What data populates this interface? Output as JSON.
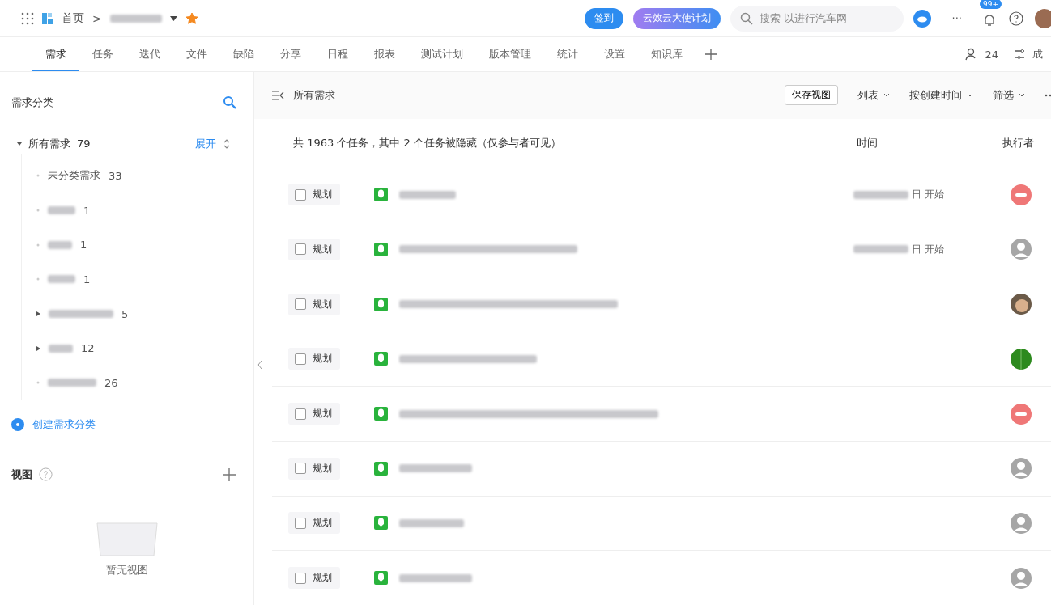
{
  "topbar": {
    "breadcrumb_home": "首页",
    "breadcrumb_sep": ">",
    "starred": true,
    "sign_button": "签到",
    "promo_button": "云效云大使计划",
    "search": {
      "placeholder": "搜索 以进行汽车网"
    },
    "more": "···",
    "badge": "99+"
  },
  "tabs": [
    {
      "label": "需求",
      "selected": true
    },
    {
      "label": "任务",
      "selected": false
    },
    {
      "label": "迭代",
      "selected": false
    },
    {
      "label": "文件",
      "selected": false
    },
    {
      "label": "缺陷",
      "selected": false
    },
    {
      "label": "分享",
      "selected": false
    },
    {
      "label": "日程",
      "selected": false
    },
    {
      "label": "报表",
      "selected": false
    },
    {
      "label": "测试计划",
      "selected": false
    },
    {
      "label": "版本管理",
      "selected": false
    },
    {
      "label": "统计",
      "selected": false
    },
    {
      "label": "设置",
      "selected": false
    },
    {
      "label": "知识库",
      "selected": false
    }
  ],
  "members": {
    "count": "24",
    "label": "成"
  },
  "sidebar": {
    "title": "需求分类",
    "root": {
      "label": "所有需求",
      "count": "79",
      "expanded": true,
      "action": "展开"
    },
    "children": [
      {
        "label": "未分类需求",
        "count": "33",
        "redacted": false,
        "has_children": false
      },
      {
        "count": "1",
        "redacted": true,
        "has_children": false
      },
      {
        "count": "1",
        "redacted": true,
        "has_children": false
      },
      {
        "count": "1",
        "redacted": true,
        "has_children": false
      },
      {
        "count": "5",
        "redacted": true,
        "has_children": true
      },
      {
        "count": "12",
        "redacted": true,
        "has_children": true
      },
      {
        "count": "26",
        "redacted": true,
        "has_children": false
      }
    ],
    "create": "创建需求分类",
    "views_title": "视图",
    "views_empty": "暂无视图"
  },
  "main": {
    "title": "所有需求",
    "save_view": "保存视图",
    "list": "列表",
    "sort": "按创建时间",
    "filter": "筛选",
    "summary": "共 1963 个任务，其中 2 个任务被隐藏（仅参与者可见）",
    "col_time": "时间",
    "col_assignee": "执行者",
    "rows": [
      {
        "checked": false,
        "status": "规划",
        "time": "日 开始",
        "avatar": {
          "kind": "red"
        }
      },
      {
        "checked": false,
        "status": "规划",
        "time": "日 开始",
        "avatar": {
          "kind": "default"
        }
      },
      {
        "checked": false,
        "status": "规划",
        "avatar": {
          "kind": "photo"
        }
      },
      {
        "checked": false,
        "status": "规划",
        "avatar": {
          "kind": "green"
        }
      },
      {
        "checked": false,
        "status": "规划",
        "avatar": {
          "kind": "red"
        }
      },
      {
        "checked": false,
        "status": "规划",
        "avatar": {
          "kind": "default"
        }
      },
      {
        "checked": false,
        "status": "规划",
        "avatar": {
          "kind": "default"
        }
      },
      {
        "checked": false,
        "status": "规划",
        "avatar": {
          "kind": "default"
        }
      }
    ]
  }
}
